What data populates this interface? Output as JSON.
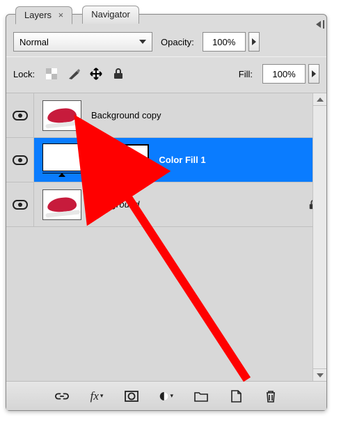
{
  "tabs": {
    "layers": "Layers",
    "navigator": "Navigator"
  },
  "blend": {
    "mode": "Normal"
  },
  "opacity": {
    "label": "Opacity:",
    "value": "100%"
  },
  "lock": {
    "label": "Lock:"
  },
  "fill": {
    "label": "Fill:",
    "value": "100%"
  },
  "layers": [
    {
      "name": "Background copy"
    },
    {
      "name": "Color Fill 1"
    },
    {
      "name": "Background"
    }
  ],
  "arrow_color": "#ff0000"
}
